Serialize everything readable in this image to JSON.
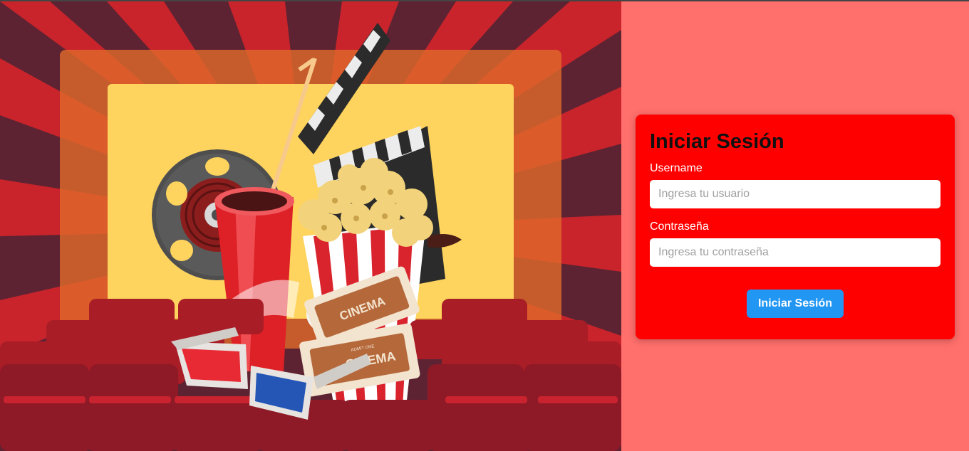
{
  "hero": {
    "ticket_header": "ADMIT ONE",
    "ticket_text": "CINEMA"
  },
  "login": {
    "title": "Iniciar Sesión",
    "username_label": "Username",
    "username_placeholder": "Ingresa tu usuario",
    "password_label": "Contraseña",
    "password_placeholder": "Ingresa tu contraseña",
    "submit_label": "Iniciar Sesión"
  },
  "colors": {
    "page_background": "#ff6f6c",
    "card_background": "#ff0000",
    "button_background": "#2196f3"
  }
}
